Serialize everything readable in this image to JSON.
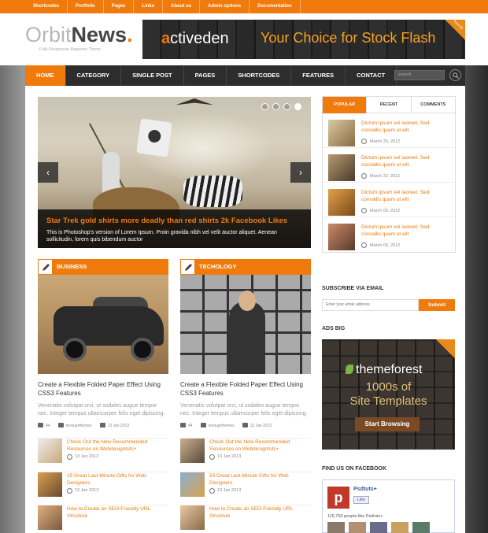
{
  "topbar": [
    "Shortcodes",
    "Portfolio",
    "Pages",
    "Links",
    "About us",
    "Admin options",
    "Documentation"
  ],
  "logo": {
    "part1": "Orbit",
    "part2": "News",
    "dot": ".",
    "tagline": "Fully Responsive Magazine Theme"
  },
  "banner": {
    "brand_a": "a",
    "brand_b": "ctiveden",
    "slogan": "Your Choice for Stock Flash",
    "corner": "from $1"
  },
  "nav": {
    "items": [
      "Home",
      "Category",
      "Single Post",
      "Pages",
      "Shortcodes",
      "Features",
      "Contact"
    ],
    "search_placeholder": "search"
  },
  "slider": {
    "title": "Star Trek gold shirts more deadly than red shirts 2k Facebook Likes",
    "description": "This is Photoshop's version of Lorem Ipsum. Proin gravida nibh vel velit auctor aliquet. Aenean sollicitudin, lorem quis bibendum auctor",
    "prev": "‹",
    "next": "›"
  },
  "tabs": {
    "labels": [
      "POPULAR",
      "RECENT",
      "COMMENTS"
    ],
    "posts": [
      {
        "title": "Dictum ipsum vel laoreet. Sed convallis quam ut elit",
        "date": "March 25, 2012"
      },
      {
        "title": "Dictum ipsum vel laoreet. Sed convallis quam ut elit",
        "date": "March 22, 2012"
      },
      {
        "title": "Dictum ipsum vel laoreet. Sed convallis quam ut elit",
        "date": "March 05, 2012"
      },
      {
        "title": "Dictum ipsum vel laoreet. Sed convallis quam ut elit",
        "date": "March 05, 2012"
      }
    ]
  },
  "subscribe": {
    "heading": "Subscribe via email",
    "placeholder": "Enter your email address",
    "button": "Submit"
  },
  "ads": {
    "heading": "Ads big",
    "brand": "themeforest",
    "line1": "1000s of",
    "line2": "Site Templates",
    "button": "Start Browsing"
  },
  "facebook": {
    "heading": "Find us on Facebook",
    "page": "Psdtuts+",
    "like": "Like",
    "count": "115,759 people like Psdtuts+."
  },
  "business": {
    "label": "Business",
    "title": "Create a Flexible Folded Paper Effect Using CSS3 Features",
    "excerpt": "Venenatis volutpat orci, ut sodales augue tempor nec. Integer tempus ullamcorper felis eget dipiscing. Maecenas orci justo, mollis at",
    "comments": "44",
    "author": "nextuprthemes",
    "date": "13 Jan 2013",
    "items": [
      {
        "title": "Check Out the New Recommended Resources on Webdesigntuts+",
        "date": "13 Jan 2013"
      },
      {
        "title": "15 Great Last-Minute Gifts for Web Designers",
        "date": "13 Jan 2013"
      },
      {
        "title": "How to Create an SEO-Friendly URL Structure",
        "date": ""
      }
    ]
  },
  "technology": {
    "label": "Techology",
    "title": "Create a Flexible Folded Paper Effect Using CSS3 Features",
    "excerpt": "Venenatis volutpat orci, ut sodales augue tempor nec. Integer tempus ullamcorper felis eget dipiscing. Maecenas orci justo, mollis at",
    "comments": "44",
    "author": "nextuprthemes",
    "date": "13 Jan 2013",
    "items": [
      {
        "title": "Check Out the New Recommended Resources on Webdesigntuts+",
        "date": "13 Jan 2013"
      },
      {
        "title": "15 Great Last-Minute Gifts for Web Designers",
        "date": "13 Jan 2013"
      },
      {
        "title": "How to Create an SEO-Friendly URL Structure",
        "date": ""
      }
    ]
  },
  "colors": {
    "accent": "#f07a0c",
    "nav": "#2d2d2d"
  }
}
